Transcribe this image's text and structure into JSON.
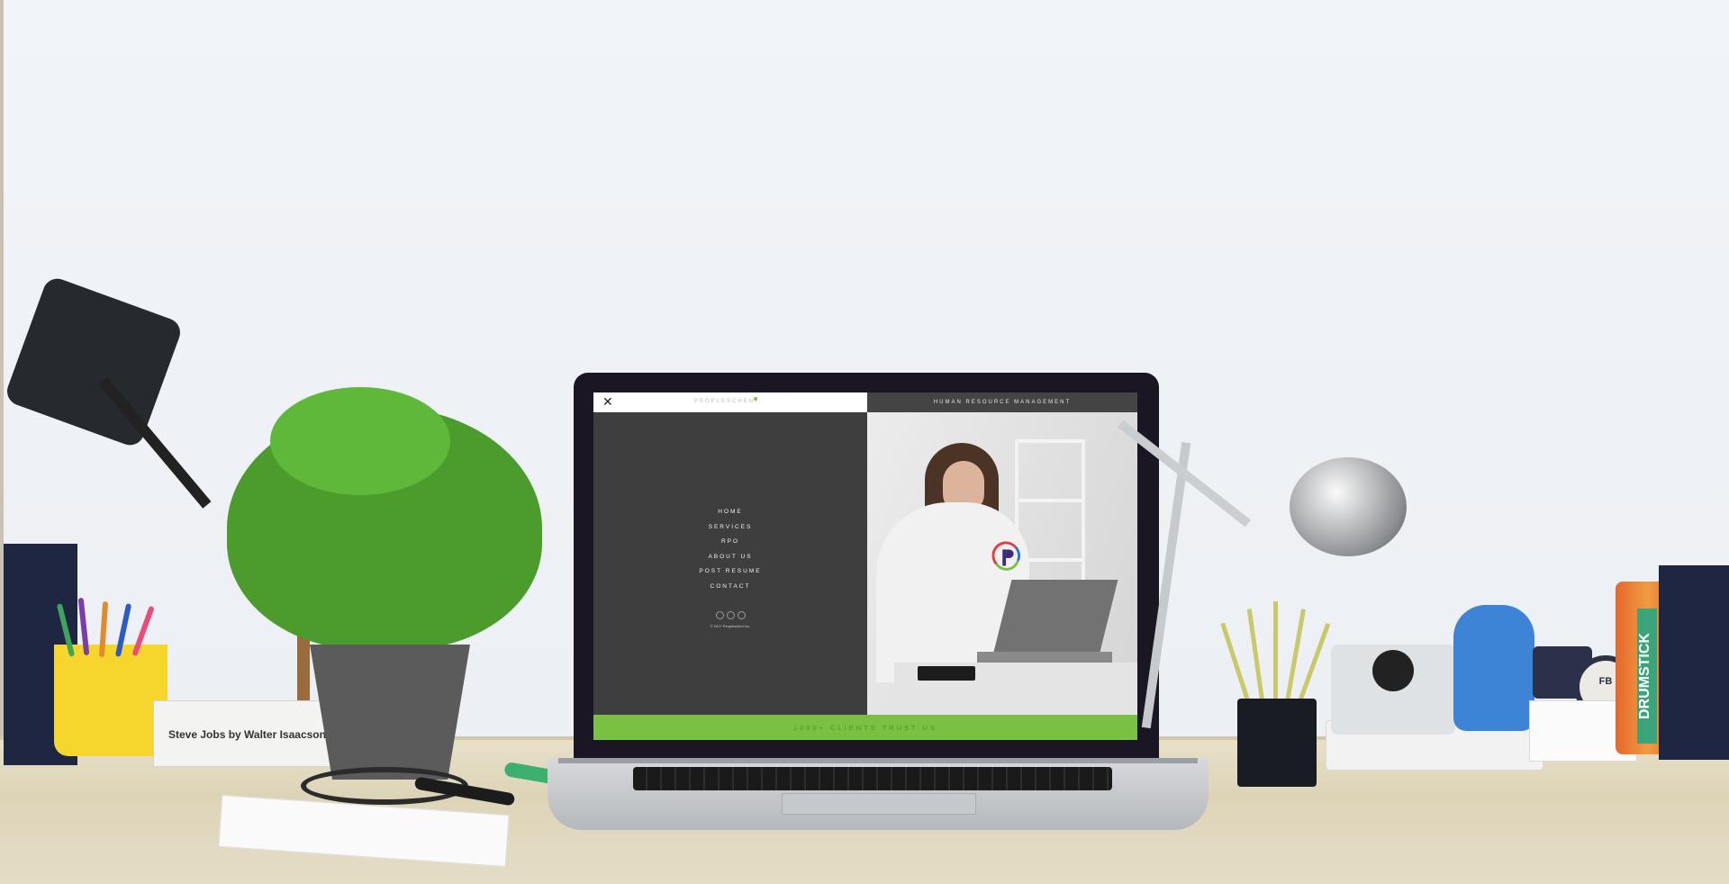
{
  "site": {
    "brand": "PEOPLESCHENT",
    "tagline": "HUMAN RESOURCE MANAGEMENT",
    "close_glyph": "✕",
    "menu": [
      "HOME",
      "SERVICES",
      "RPO",
      "ABOUT US",
      "POST RESUME",
      "CONTACT"
    ],
    "social_icons": [
      "facebook-icon",
      "twitter-icon",
      "linkedin-icon"
    ],
    "copyright": "© 2017 Peoplescient Inc.",
    "clients_banner": "1000+ CLIENTS TRUST US"
  },
  "scene": {
    "book_title": "Steve Jobs by Walter Isaacson",
    "tin_label": "FB",
    "can_label": "DRUMSTICK"
  },
  "colors": {
    "accent_green": "#7ac043",
    "panel_dark": "#3e3e3e",
    "header_dark": "#444444"
  }
}
